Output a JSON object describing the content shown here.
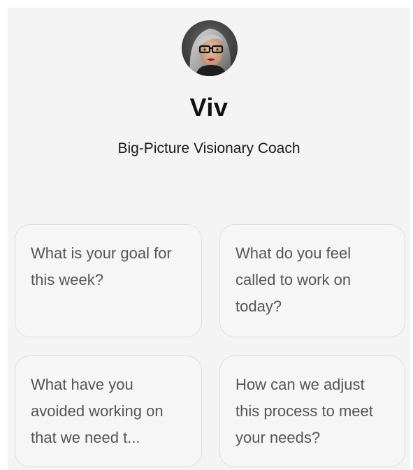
{
  "coach": {
    "name": "Viv",
    "title": "Big-Picture Visionary Coach",
    "avatar_icon": "coach-portrait-avatar"
  },
  "prompts": [
    {
      "text": "What is your goal for this week?"
    },
    {
      "text": "What do you feel called to work on today?"
    },
    {
      "text": "What have you avoided working on that we need t..."
    },
    {
      "text": "How can we adjust this process to meet your needs?"
    }
  ],
  "colors": {
    "panel_bg": "#f4f4f4",
    "card_border": "#dedede",
    "card_text": "#555555",
    "heading_text": "#111111"
  }
}
